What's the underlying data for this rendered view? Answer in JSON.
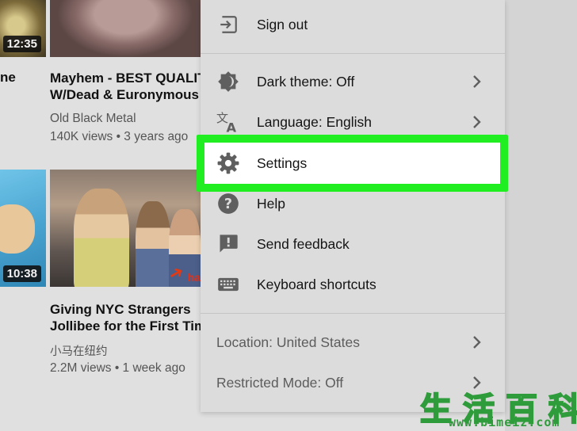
{
  "videos": [
    {
      "duration": "12:35",
      "title_clipped": "ne"
    },
    {
      "title_line1": "Mayhem - BEST QUALIT",
      "title_line2": "W/Dead & Euronymous",
      "channel": "Old Black Metal",
      "meta": "140K views • 3 years ago"
    },
    {
      "duration": "10:38"
    },
    {
      "title_line1": "Giving NYC Strangers",
      "title_line2": "Jollibee for the First Tim",
      "channel": "小马在纽约",
      "meta": "2.2M views • 1 week ago",
      "overlay_text": "ha"
    }
  ],
  "menu": {
    "sign_out": "Sign out",
    "dark_theme": "Dark theme: Off",
    "language": "Language: English",
    "settings": "Settings",
    "help": "Help",
    "send_feedback": "Send feedback",
    "keyboard_shortcuts": "Keyboard shortcuts",
    "location": "Location: United States",
    "restricted_mode": "Restricted Mode: Off"
  },
  "icons": {
    "sign_out": "sign-out-icon",
    "dark_theme": "dark-theme-icon",
    "language": "translate-icon",
    "settings": "gear-icon",
    "help": "help-icon",
    "send_feedback": "feedback-icon",
    "keyboard_shortcuts": "keyboard-icon",
    "chevron": "chevron-right-icon"
  },
  "colors": {
    "highlight_border": "#20ee20",
    "menu_background": "#dcdcdc",
    "icon_gray": "#5f5f5f",
    "watermark_green": "#2e9c3a"
  },
  "watermark": {
    "chars": "生活百科",
    "url": "www.bimeiz.com"
  }
}
